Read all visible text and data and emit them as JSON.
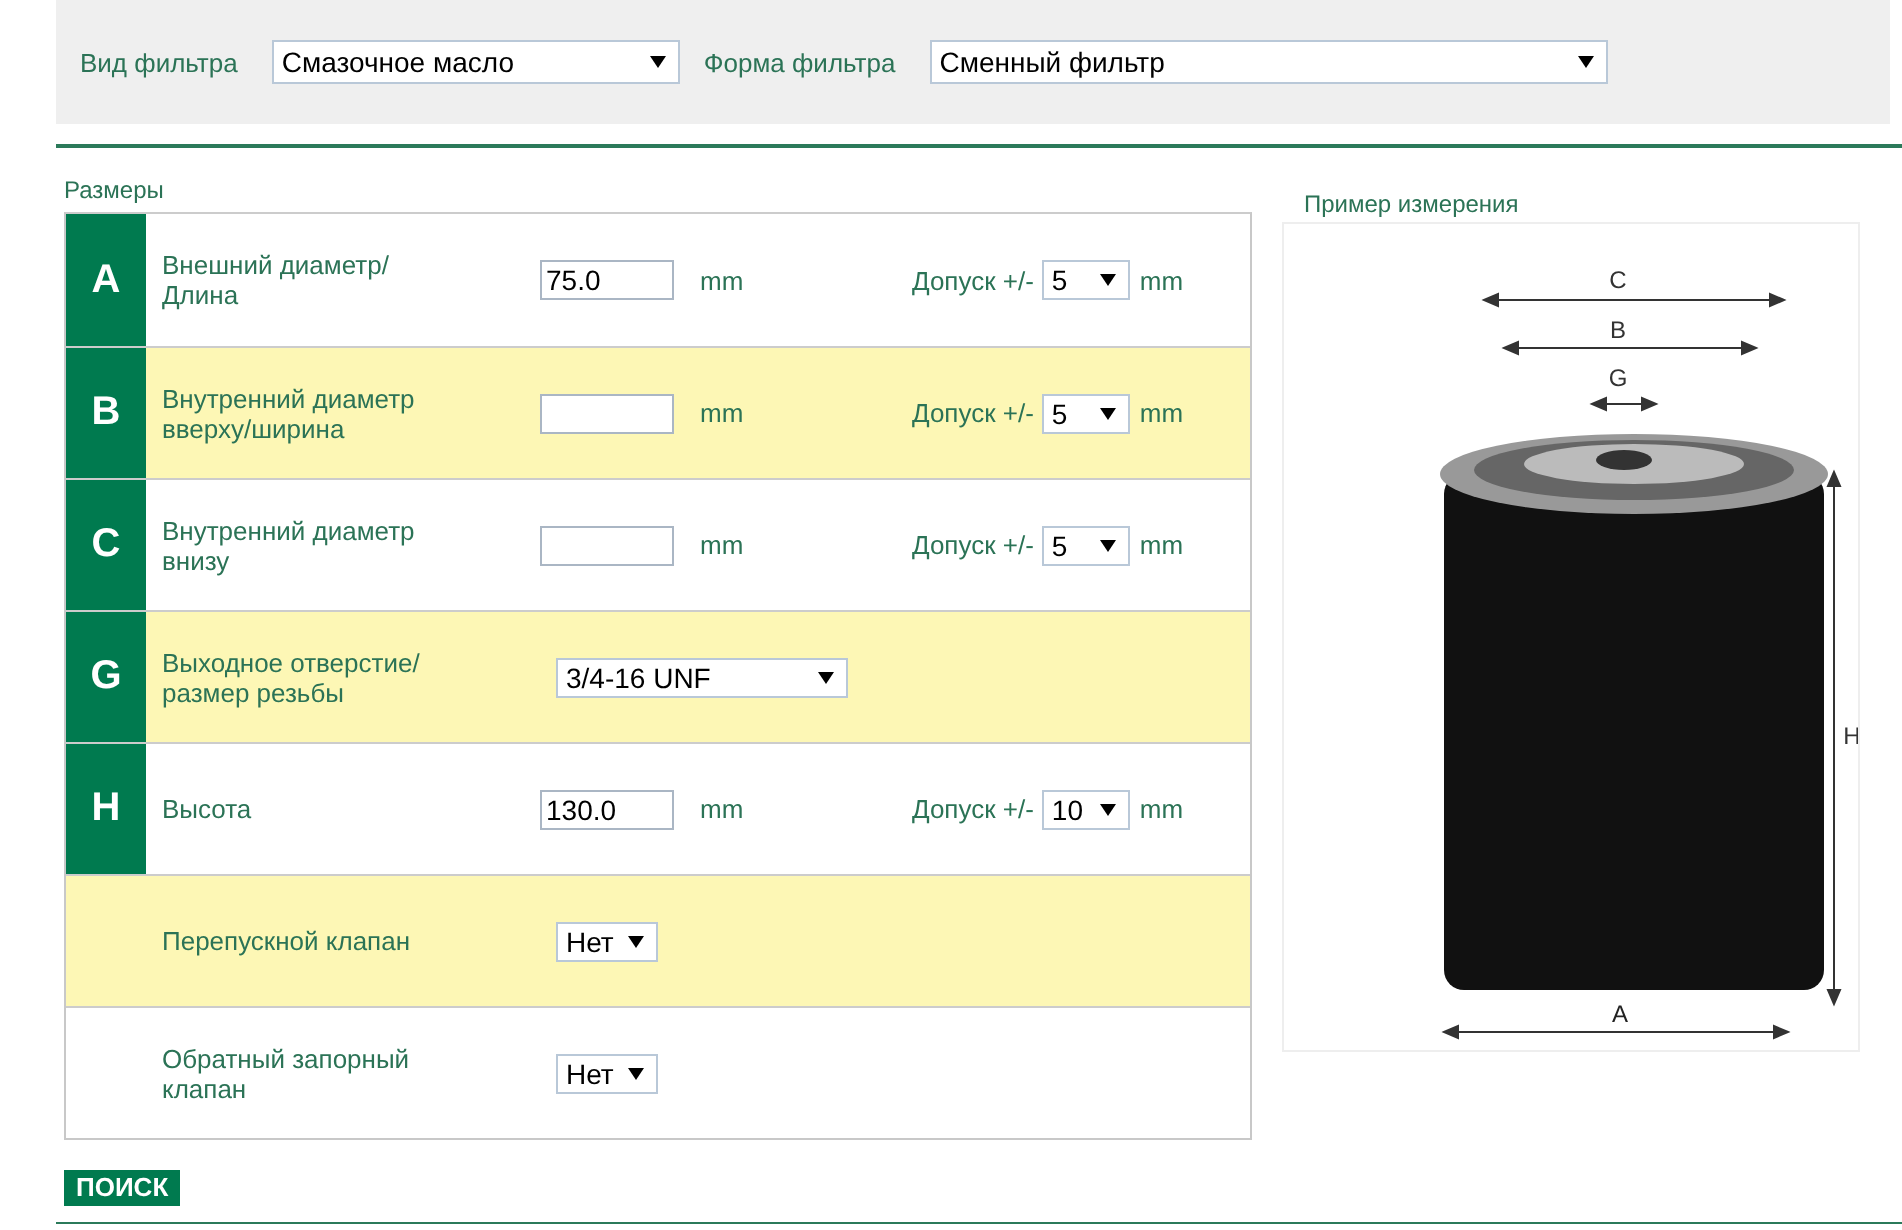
{
  "filter_bar": {
    "fields": [
      {
        "label": "Вид фильтра",
        "value": "Смазочное масло"
      },
      {
        "label": "Форма фильтра",
        "value": "Сменный фильтр"
      }
    ]
  },
  "dimensions": {
    "title": "Размеры",
    "rows": [
      {
        "kind": "measure",
        "letter": "A",
        "label": "Внешний диаметр/\nДлина",
        "value": "75.0",
        "unit": "mm",
        "tolerance_label": "Допуск +/-",
        "tolerance": "5",
        "tolerance_unit": "mm"
      },
      {
        "kind": "measure",
        "letter": "B",
        "label": "Внутренний диаметр\nвверху/ширина",
        "unit": "mm",
        "tolerance_label": "Допуск +/-",
        "tolerance": "5",
        "tolerance_unit": "mm"
      },
      {
        "kind": "measure",
        "letter": "C",
        "label": "Внутренний диаметр\nвнизу",
        "unit": "mm",
        "tolerance_label": "Допуск +/-",
        "tolerance": "5",
        "tolerance_unit": "mm"
      },
      {
        "kind": "thread",
        "letter": "G",
        "label": "Выходное отверстие/\nразмер резьбы",
        "value": "3/4-16 UNF"
      },
      {
        "kind": "measure",
        "letter": "H",
        "label": "Высота",
        "value": "130.0",
        "unit": "mm",
        "tolerance_label": "Допуск +/-",
        "tolerance": "10",
        "tolerance_unit": "mm"
      },
      {
        "kind": "choice",
        "label": "Перепускной клапан",
        "value": "Нет"
      },
      {
        "kind": "choice",
        "label": "Обратный запорный\nклапан",
        "value": "Нет"
      }
    ]
  },
  "search_button": "ПОИСК",
  "example": {
    "title": "Пример измерения",
    "labels": {
      "c": "C",
      "b": "B",
      "g": "G",
      "h": "H",
      "a": "A"
    }
  }
}
